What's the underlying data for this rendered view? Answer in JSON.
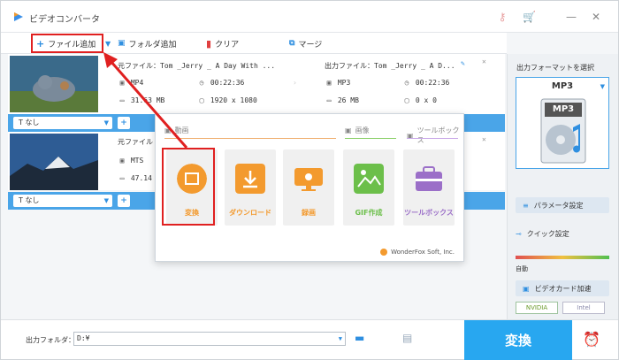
{
  "app": {
    "title": "ビデオコンバータ"
  },
  "toolbar": {
    "add_file": "ファイル追加",
    "add_folder": "フォルダ追加",
    "clear": "クリア",
    "merge": "マージ"
  },
  "items": [
    {
      "source": "元ファイル：Tom _Jerry _ A Day With ...",
      "format": "MP4",
      "duration": "00:22:36",
      "size": "31.63 MB",
      "resolution": "1920 x 1080",
      "output": "出力ファイル：Tom _Jerry _ A D...",
      "out_format": "MP3",
      "out_duration": "00:22:36",
      "out_size": "26 MB",
      "out_resolution": "0 x 0",
      "subtitle": "なし"
    },
    {
      "source": "元ファイル",
      "format": "MTS",
      "size": "47.14",
      "subtitle": "なし"
    }
  ],
  "popup": {
    "categories": {
      "video": "動画",
      "image": "画像",
      "toolbox": "ツールボックス"
    },
    "tiles": [
      {
        "label": "変換",
        "color": "#f39a2e"
      },
      {
        "label": "ダウンロード",
        "color": "#f39a2e"
      },
      {
        "label": "録画",
        "color": "#f39a2e"
      },
      {
        "label": "GIF作成",
        "color": "#6cbf4a"
      },
      {
        "label": "ツールボックス",
        "color": "#9b6fc8"
      }
    ],
    "brand": "WonderFox Soft, Inc."
  },
  "right": {
    "format_label": "出力フォーマットを選択",
    "format": "MP3",
    "param": "パラメータ設定",
    "quick": "クイック設定",
    "quality_low": "自動",
    "gpu": "ビデオカード加速",
    "nvidia": "NVIDIA",
    "intel": "Intel"
  },
  "bottom": {
    "out_label": "出力フォルダ：",
    "out_path": "D:¥",
    "convert": "変換"
  },
  "colors": {
    "accent": "#28a7f0",
    "highlight": "#e02020",
    "orange": "#f39a2e"
  }
}
